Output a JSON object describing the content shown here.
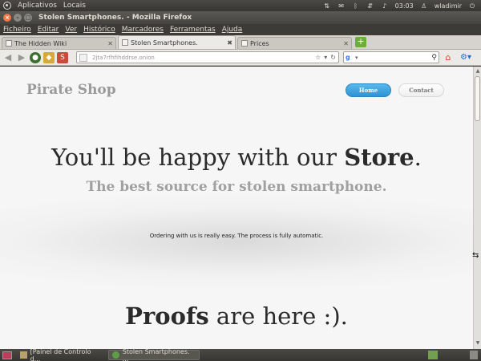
{
  "top_panel": {
    "menus": [
      "Aplicativos",
      "Locais"
    ],
    "clock": "03:03",
    "user": "wladimir"
  },
  "window": {
    "title": "Stolen Smartphones. - Mozilla Firefox"
  },
  "menubar": {
    "items": [
      "Ficheiro",
      "Editar",
      "Ver",
      "Histórico",
      "Marcadores",
      "Ferramentas",
      "Ajuda"
    ]
  },
  "tabs": [
    {
      "label": "The Hidden Wiki",
      "active": false
    },
    {
      "label": "Stolen Smartphones.",
      "active": true
    },
    {
      "label": "Prices",
      "active": false
    }
  ],
  "navbar": {
    "url": "2jta7rfhfihddrse.onion",
    "search_engine": "g"
  },
  "page": {
    "brand": "Pirate Shop",
    "nav": {
      "home": "Home",
      "contact": "Contact"
    },
    "hero_title_pre": "You'll be happy with our ",
    "hero_title_bold": "Store",
    "hero_title_post": ".",
    "hero_subtitle": "The best source for stolen smartphone.",
    "info_text": "Ordering with us is really easy. The process is fully automatic.",
    "proofs_bold": "Proofs",
    "proofs_rest": " are here :)."
  },
  "taskbar": {
    "tasks": [
      {
        "label": "[Painel de Controlo d...",
        "active": false
      },
      {
        "label": "Stolen Smartphones. ...",
        "active": true
      }
    ]
  },
  "colors": {
    "home_button": "#2d93d3",
    "brand_text": "#9a9a9a",
    "ubuntu_panel": "#3c3b37"
  }
}
